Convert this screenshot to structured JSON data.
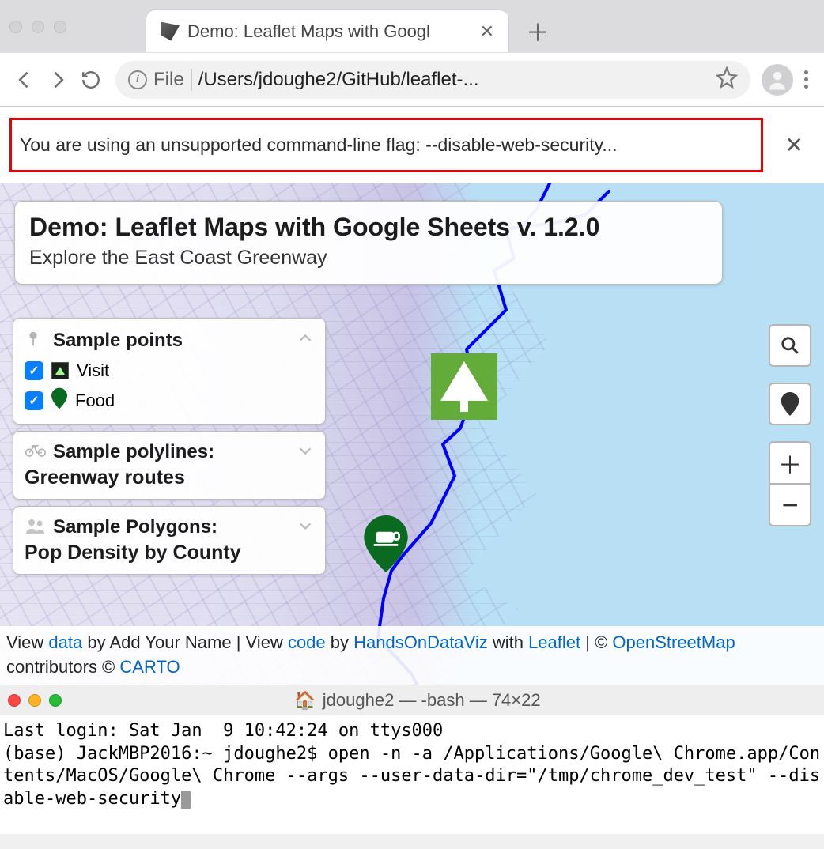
{
  "browser": {
    "tab_title": "Demo: Leaflet Maps with Googl",
    "file_label": "File",
    "url_path": "/Users/jdoughe2/GitHub/leaflet-..."
  },
  "warning": {
    "text": "You are using an unsupported command-line flag: --disable-web-security..."
  },
  "title_card": {
    "title": "Demo: Leaflet Maps with Google Sheets v. 1.2.0",
    "subtitle": "Explore the East Coast Greenway"
  },
  "legend": {
    "points": {
      "heading": "Sample points",
      "items": [
        {
          "label": "Visit",
          "checked": true
        },
        {
          "label": "Food",
          "checked": true
        }
      ]
    },
    "polylines": {
      "heading": "Sample polylines:",
      "sub": "Greenway routes"
    },
    "polygons": {
      "heading": "Sample Polygons:",
      "sub": "Pop Density by County"
    }
  },
  "attribution": {
    "t1": "View ",
    "data": "data",
    "t2": " by Add Your Name | View ",
    "code": "code",
    "t3": " by ",
    "hodv": "HandsOnDataViz",
    "t4": " with ",
    "leaflet": "Leaflet",
    "t5": " | © ",
    "osm": "OpenStreetMap",
    "t6": " contributors © ",
    "carto": "CARTO"
  },
  "terminal": {
    "title": "jdoughe2 — -bash — 74×22",
    "line1": "Last login: Sat Jan  9 10:42:24 on ttys000",
    "line2": "(base) JackMBP2016:~ jdoughe2$ open -n -a /Applications/Google\\ Chrome.app/Contents/MacOS/Google\\ Chrome --args --user-data-dir=\"/tmp/chrome_dev_test\" --disable-web-security"
  }
}
